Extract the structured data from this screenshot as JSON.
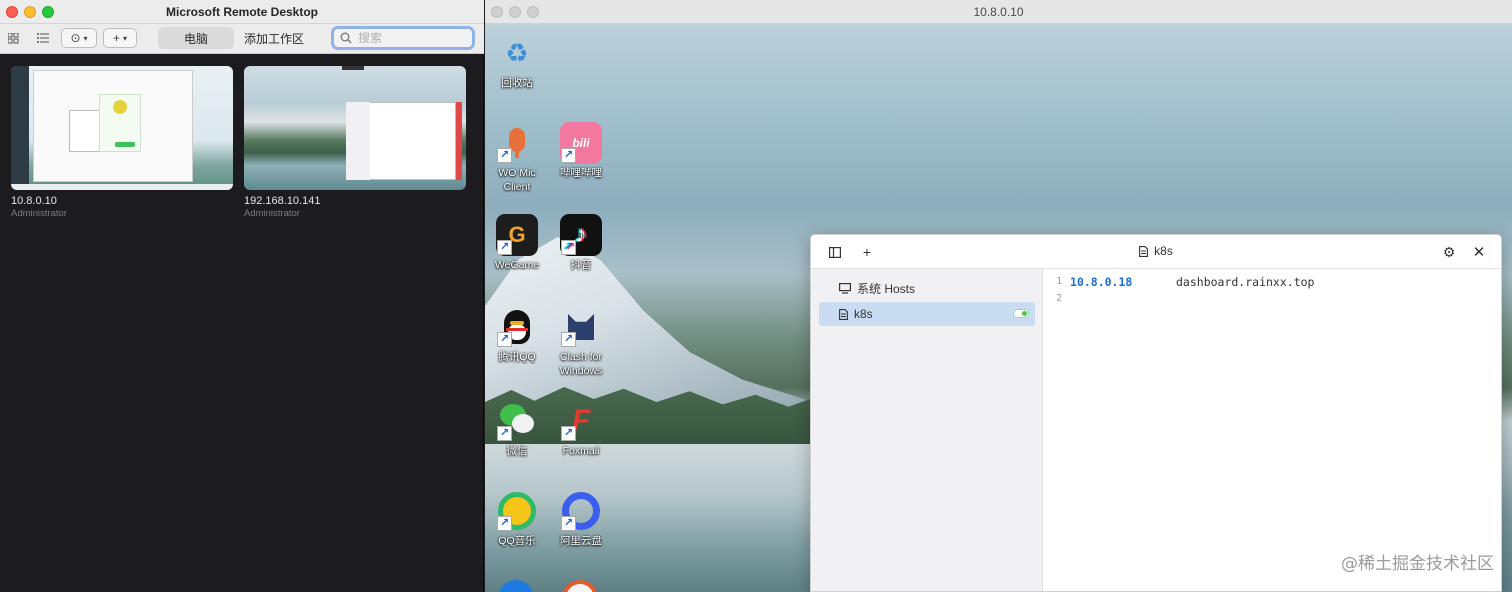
{
  "left_app": {
    "title": "Microsoft Remote Desktop",
    "toolbar": {
      "tabs": [
        {
          "label": "电脑",
          "active": true
        },
        {
          "label": "添加工作区",
          "active": false
        }
      ],
      "search_placeholder": "搜索",
      "add_label": "+"
    },
    "pcs": [
      {
        "name": "10.8.0.10",
        "user": "Administrator"
      },
      {
        "name": "192.168.10.141",
        "user": "Administrator"
      }
    ]
  },
  "remote": {
    "title": "10.8.0.10",
    "desktop_icons": [
      {
        "label": "回收站",
        "icon": "recycle-bin-icon",
        "color": "#d7e6f2",
        "glyph": "♻",
        "shortcut": false
      },
      {
        "label": "WO Mic\nClient",
        "icon": "microphone-icon",
        "color": "#e8703a",
        "glyph": "🎤",
        "shortcut": true
      },
      {
        "label": "哔哩哔哩",
        "icon": "bilibili-icon",
        "color": "#f2789f",
        "glyph": "bili",
        "shortcut": true
      },
      {
        "label": "WeGame",
        "icon": "wegame-icon",
        "color": "#1d1d1d",
        "glyph": "G",
        "shortcut": true
      },
      {
        "label": "抖音",
        "icon": "douyin-icon",
        "color": "#111111",
        "glyph": "♪",
        "shortcut": true
      },
      {
        "label": "腾讯QQ",
        "icon": "qq-penguin-icon",
        "color": "#1a1a1a",
        "glyph": "Q",
        "shortcut": true
      },
      {
        "label": "Clash for\nWindows",
        "icon": "clash-cat-icon",
        "color": "#2c3e6b",
        "glyph": "🐱",
        "shortcut": true
      },
      {
        "label": "微信",
        "icon": "wechat-icon",
        "color": "#3fbf4a",
        "glyph": "💬",
        "shortcut": true
      },
      {
        "label": "Foxmail",
        "icon": "foxmail-icon",
        "color": "#e23b2b",
        "glyph": "F",
        "shortcut": true
      },
      {
        "label": "QQ音乐",
        "icon": "qq-music-icon",
        "color": "#f5c518",
        "glyph": "♫",
        "shortcut": true
      },
      {
        "label": "阿里云盘",
        "icon": "aliyun-drive-icon",
        "color": "#3c5ef0",
        "glyph": "☁",
        "shortcut": true
      }
    ]
  },
  "hosts_app": {
    "title": "k8s",
    "sidebar": [
      {
        "label": "系统 Hosts",
        "icon": "monitor-icon",
        "selected": false
      },
      {
        "label": "k8s",
        "icon": "document-icon",
        "selected": true,
        "enabled": true
      }
    ],
    "editor_lines": [
      {
        "num": "1",
        "ip": "10.8.0.18",
        "host": "dashboard.rainxx.top"
      },
      {
        "num": "2",
        "ip": "",
        "host": ""
      }
    ]
  },
  "watermark": "@稀土掘金技术社区"
}
